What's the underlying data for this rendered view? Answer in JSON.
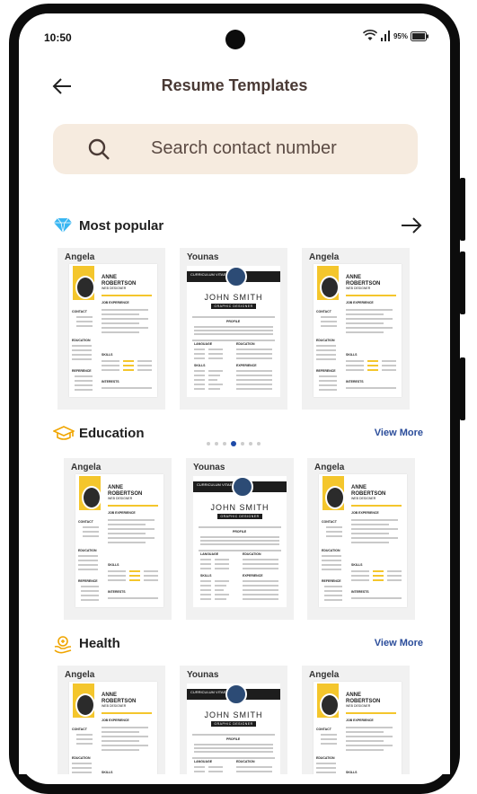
{
  "status": {
    "time": "10:50",
    "battery": "95%"
  },
  "header": {
    "title": "Resume Templates"
  },
  "search": {
    "placeholder": "Search contact number"
  },
  "sections": [
    {
      "label": "Most popular",
      "icon": "diamond-icon",
      "action": "arrow",
      "cards": [
        {
          "name": "Angela"
        },
        {
          "name": "Younas"
        },
        {
          "name": "Angela"
        }
      ]
    },
    {
      "label": "Education",
      "icon": "graduation-cap-icon",
      "action": "View More",
      "cards": [
        {
          "name": "Angela"
        },
        {
          "name": "Younas"
        },
        {
          "name": "Angela"
        }
      ]
    },
    {
      "label": "Health",
      "icon": "health-icon",
      "action": "View More",
      "cards": [
        {
          "name": "Angela"
        },
        {
          "name": "Younas"
        },
        {
          "name": "Angela"
        }
      ]
    }
  ],
  "resume_a": {
    "first": "ANNE",
    "last": "ROBERTSON",
    "role": "WEB DESIGNER",
    "headings": [
      "JOB EXPERIENCE",
      "CONTACT",
      "EDUCATION",
      "SKILLS",
      "REFERENCE",
      "INTERESTS"
    ]
  },
  "resume_b": {
    "cv": "CURRICULUM VITAE",
    "name": "JOHN SMITH",
    "role": "GRAPHIC DESIGNER",
    "headings": [
      "PROFILE",
      "LANGUAGE",
      "EDUCATION",
      "SKILLS",
      "EXPERIENCE"
    ]
  },
  "pager": {
    "count": 7,
    "active": 4
  },
  "colors": {
    "accent": "#f4c62c",
    "link": "#2a4c9a",
    "search_bg": "#f6ebdf",
    "title": "#4a3a35"
  }
}
